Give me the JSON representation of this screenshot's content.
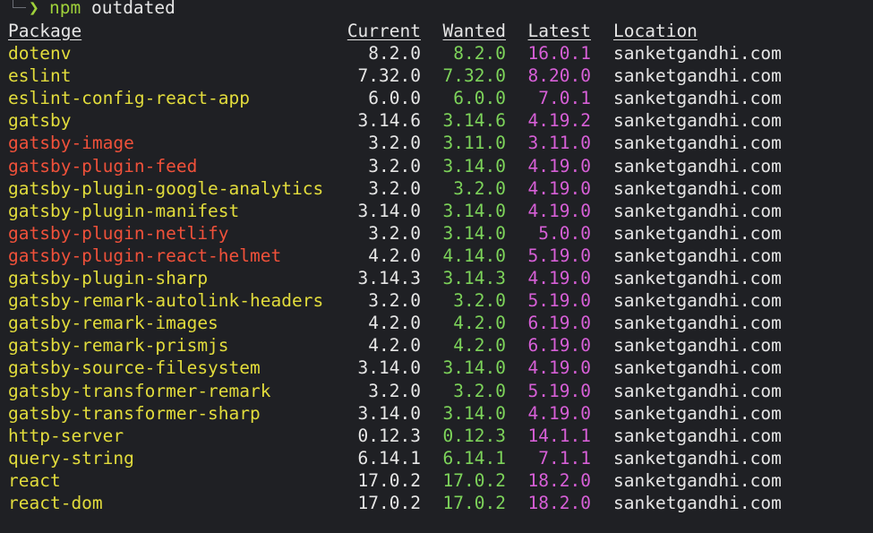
{
  "prompt": {
    "arrow": "❯",
    "command_bin": "npm",
    "command_args": " outdated"
  },
  "headers": {
    "package": "Package",
    "current": "Current",
    "wanted": "Wanted",
    "latest": "Latest",
    "location": "Location"
  },
  "colors": {
    "package_minor": "#e2dc3c",
    "package_major": "#f0513a",
    "wanted": "#7dd35a",
    "latest": "#d75fd7"
  },
  "rows": [
    {
      "package": "dotenv",
      "current": "8.2.0",
      "wanted": "8.2.0",
      "latest": "16.0.1",
      "location": "sanketgandhi.com",
      "status": "yellow"
    },
    {
      "package": "eslint",
      "current": "7.32.0",
      "wanted": "7.32.0",
      "latest": "8.20.0",
      "location": "sanketgandhi.com",
      "status": "yellow"
    },
    {
      "package": "eslint-config-react-app",
      "current": "6.0.0",
      "wanted": "6.0.0",
      "latest": "7.0.1",
      "location": "sanketgandhi.com",
      "status": "yellow"
    },
    {
      "package": "gatsby",
      "current": "3.14.6",
      "wanted": "3.14.6",
      "latest": "4.19.2",
      "location": "sanketgandhi.com",
      "status": "yellow"
    },
    {
      "package": "gatsby-image",
      "current": "3.2.0",
      "wanted": "3.11.0",
      "latest": "3.11.0",
      "location": "sanketgandhi.com",
      "status": "red"
    },
    {
      "package": "gatsby-plugin-feed",
      "current": "3.2.0",
      "wanted": "3.14.0",
      "latest": "4.19.0",
      "location": "sanketgandhi.com",
      "status": "red"
    },
    {
      "package": "gatsby-plugin-google-analytics",
      "current": "3.2.0",
      "wanted": "3.2.0",
      "latest": "4.19.0",
      "location": "sanketgandhi.com",
      "status": "yellow"
    },
    {
      "package": "gatsby-plugin-manifest",
      "current": "3.14.0",
      "wanted": "3.14.0",
      "latest": "4.19.0",
      "location": "sanketgandhi.com",
      "status": "yellow"
    },
    {
      "package": "gatsby-plugin-netlify",
      "current": "3.2.0",
      "wanted": "3.14.0",
      "latest": "5.0.0",
      "location": "sanketgandhi.com",
      "status": "red"
    },
    {
      "package": "gatsby-plugin-react-helmet",
      "current": "4.2.0",
      "wanted": "4.14.0",
      "latest": "5.19.0",
      "location": "sanketgandhi.com",
      "status": "red"
    },
    {
      "package": "gatsby-plugin-sharp",
      "current": "3.14.3",
      "wanted": "3.14.3",
      "latest": "4.19.0",
      "location": "sanketgandhi.com",
      "status": "yellow"
    },
    {
      "package": "gatsby-remark-autolink-headers",
      "current": "3.2.0",
      "wanted": "3.2.0",
      "latest": "5.19.0",
      "location": "sanketgandhi.com",
      "status": "yellow"
    },
    {
      "package": "gatsby-remark-images",
      "current": "4.2.0",
      "wanted": "4.2.0",
      "latest": "6.19.0",
      "location": "sanketgandhi.com",
      "status": "yellow"
    },
    {
      "package": "gatsby-remark-prismjs",
      "current": "4.2.0",
      "wanted": "4.2.0",
      "latest": "6.19.0",
      "location": "sanketgandhi.com",
      "status": "yellow"
    },
    {
      "package": "gatsby-source-filesystem",
      "current": "3.14.0",
      "wanted": "3.14.0",
      "latest": "4.19.0",
      "location": "sanketgandhi.com",
      "status": "yellow"
    },
    {
      "package": "gatsby-transformer-remark",
      "current": "3.2.0",
      "wanted": "3.2.0",
      "latest": "5.19.0",
      "location": "sanketgandhi.com",
      "status": "yellow"
    },
    {
      "package": "gatsby-transformer-sharp",
      "current": "3.14.0",
      "wanted": "3.14.0",
      "latest": "4.19.0",
      "location": "sanketgandhi.com",
      "status": "yellow"
    },
    {
      "package": "http-server",
      "current": "0.12.3",
      "wanted": "0.12.3",
      "latest": "14.1.1",
      "location": "sanketgandhi.com",
      "status": "yellow"
    },
    {
      "package": "query-string",
      "current": "6.14.1",
      "wanted": "6.14.1",
      "latest": "7.1.1",
      "location": "sanketgandhi.com",
      "status": "yellow"
    },
    {
      "package": "react",
      "current": "17.0.2",
      "wanted": "17.0.2",
      "latest": "18.2.0",
      "location": "sanketgandhi.com",
      "status": "yellow"
    },
    {
      "package": "react-dom",
      "current": "17.0.2",
      "wanted": "17.0.2",
      "latest": "18.2.0",
      "location": "sanketgandhi.com",
      "status": "yellow"
    }
  ]
}
